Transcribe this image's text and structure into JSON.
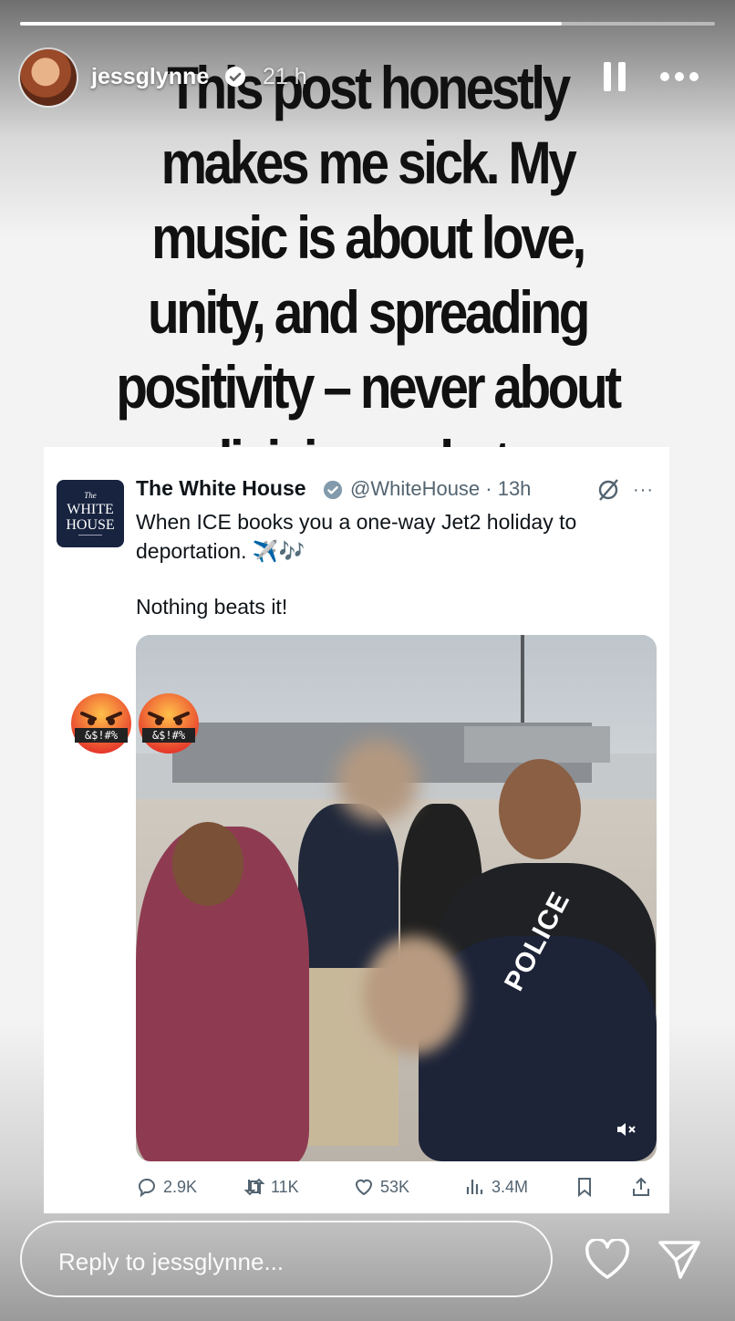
{
  "story": {
    "username": "jessglynne",
    "time": "21 h",
    "progress": 0.78,
    "headline": "This post honestly makes me sick. My music is about love, unity, and spreading positivity – never about division or hate"
  },
  "tweet": {
    "logo_small": "The",
    "logo_text": "WHITE HOUSE",
    "name": "The White House",
    "handle": "@WhiteHouse · 13h",
    "more": "···",
    "text": "When ICE books you a one-way Jet2 holiday to deportation. ✈️🎶",
    "text2": "Nothing beats it!",
    "media_overlay": "POLICE",
    "replies": "2.9K",
    "retweets": "11K",
    "likes": "53K",
    "views": "3.4M"
  },
  "stickers": {
    "label": "&$!#%"
  },
  "reply": {
    "placeholder": "Reply to jessglynne..."
  }
}
